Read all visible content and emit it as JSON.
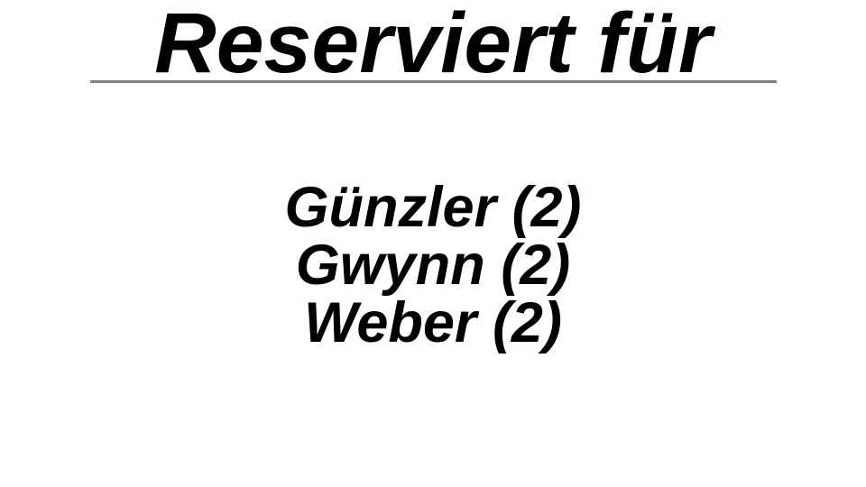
{
  "title": "Reserviert für",
  "colors": {
    "rule": "#808080",
    "text": "#000000",
    "background": "#ffffff"
  },
  "reservations": [
    {
      "label": "Günzler (2)"
    },
    {
      "label": "Gwynn (2)"
    },
    {
      "label": "Weber (2)"
    }
  ]
}
